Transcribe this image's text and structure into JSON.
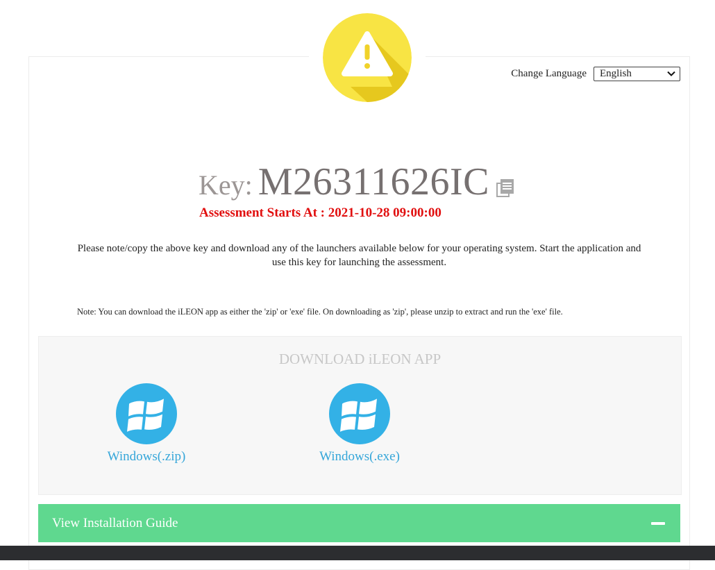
{
  "language": {
    "label": "Change Language",
    "selected": "English"
  },
  "key": {
    "label": "Key:",
    "value": "M26311626IC"
  },
  "assessment_start": "Assessment Starts At : 2021-10-28 09:00:00",
  "instructions": "Please note/copy the above key and download any of the launchers available below for your operating system. Start the application and use this key for launching the assessment.",
  "note": "Note: You can download the iLEON app as either the 'zip' or 'exe' file. On downloading as 'zip', please unzip to extract and run the 'exe' file.",
  "download": {
    "title": "DOWNLOAD iLEON APP",
    "launchers": [
      {
        "label": "Windows(.zip)",
        "icon": "windows-icon"
      },
      {
        "label": "Windows(.exe)",
        "icon": "windows-icon"
      }
    ]
  },
  "guide": {
    "label": "View Installation Guide"
  },
  "colors": {
    "warning": "#f8e444",
    "accent_red": "#e10f0f",
    "launcher_blue": "#33b1e6",
    "guide_green": "#5fd88f"
  }
}
